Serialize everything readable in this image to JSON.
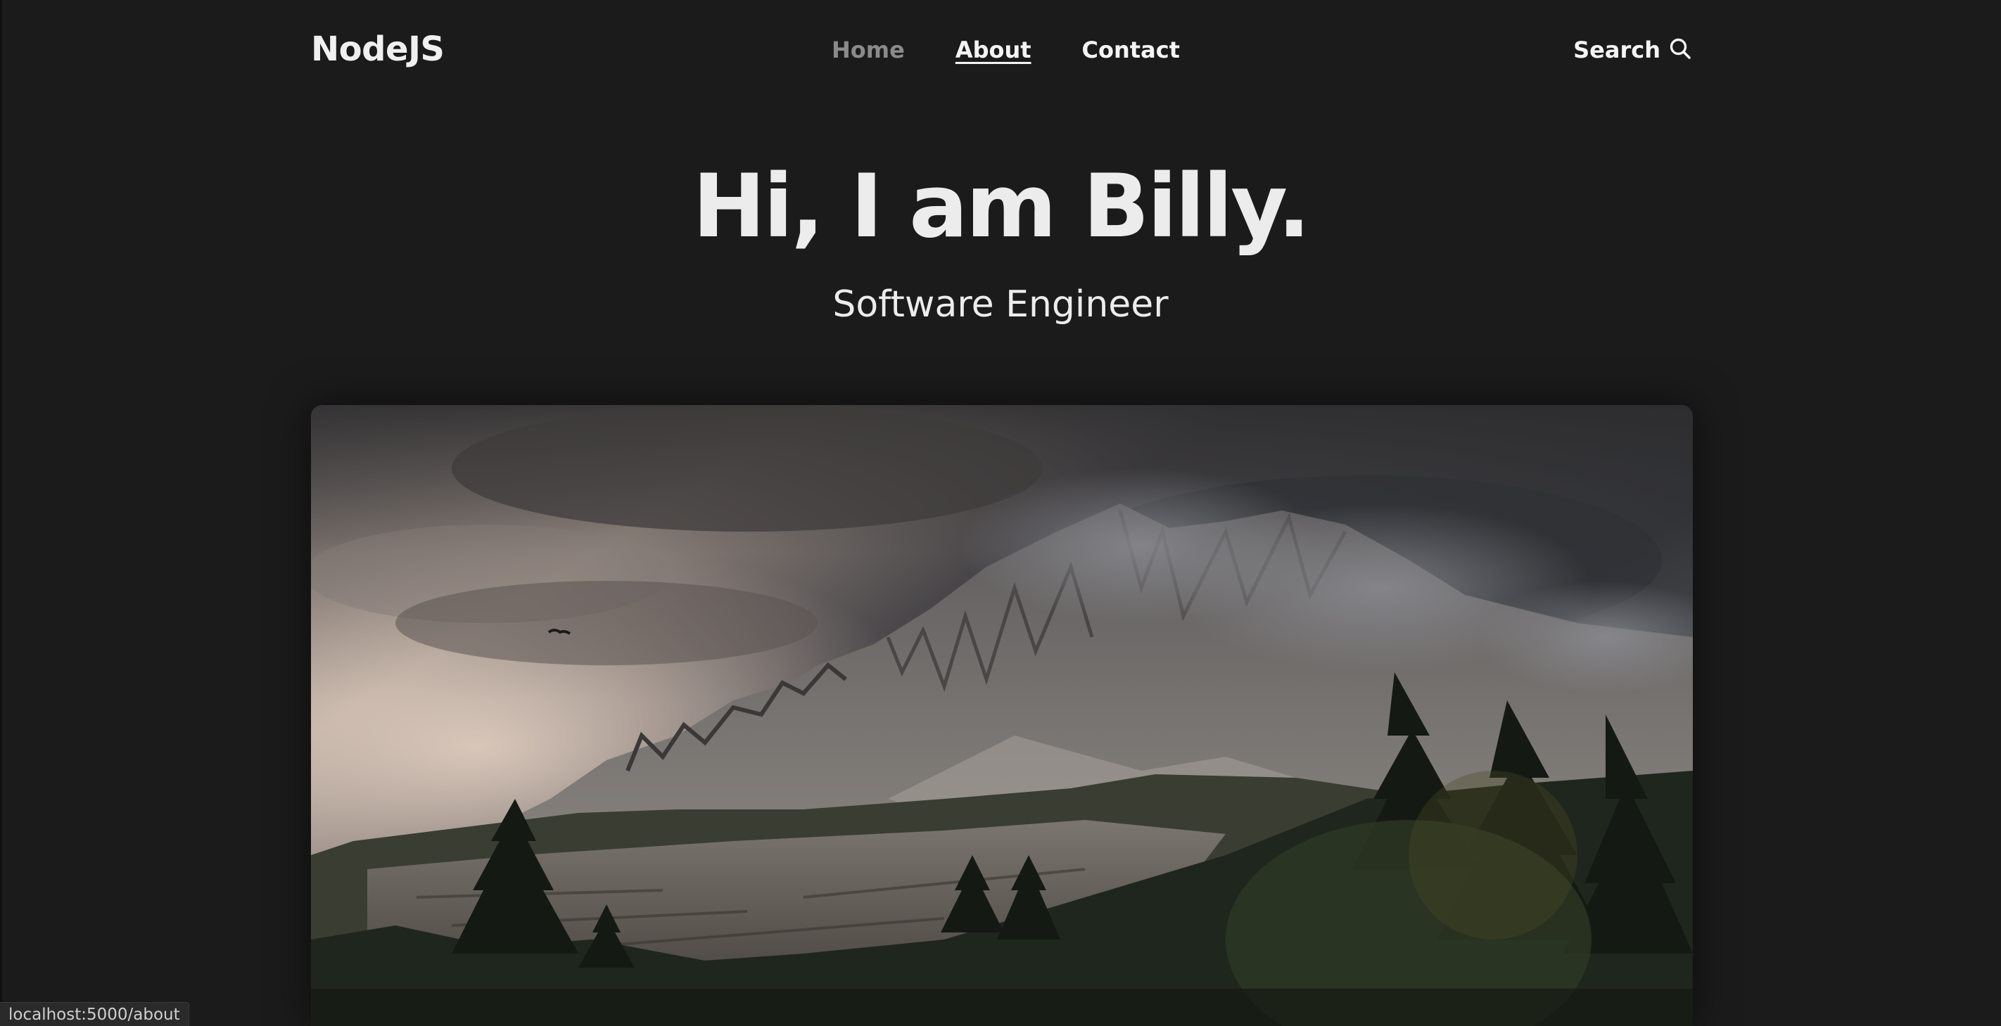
{
  "brand": {
    "logo": "NodeJS"
  },
  "nav": {
    "items": [
      {
        "label": "Home"
      },
      {
        "label": "About"
      },
      {
        "label": "Contact"
      }
    ],
    "active": "About"
  },
  "search": {
    "label": "Search",
    "icon": "search-icon"
  },
  "hero": {
    "title": "Hi, I am Billy.",
    "subtitle": "Software Engineer",
    "image": "mountain-landscape-photo"
  },
  "status_bar": {
    "url": "localhost:5000/about"
  },
  "colors": {
    "background": "#1b1b1b",
    "text": "#ececec",
    "muted_nav": "#8a8a8a"
  }
}
